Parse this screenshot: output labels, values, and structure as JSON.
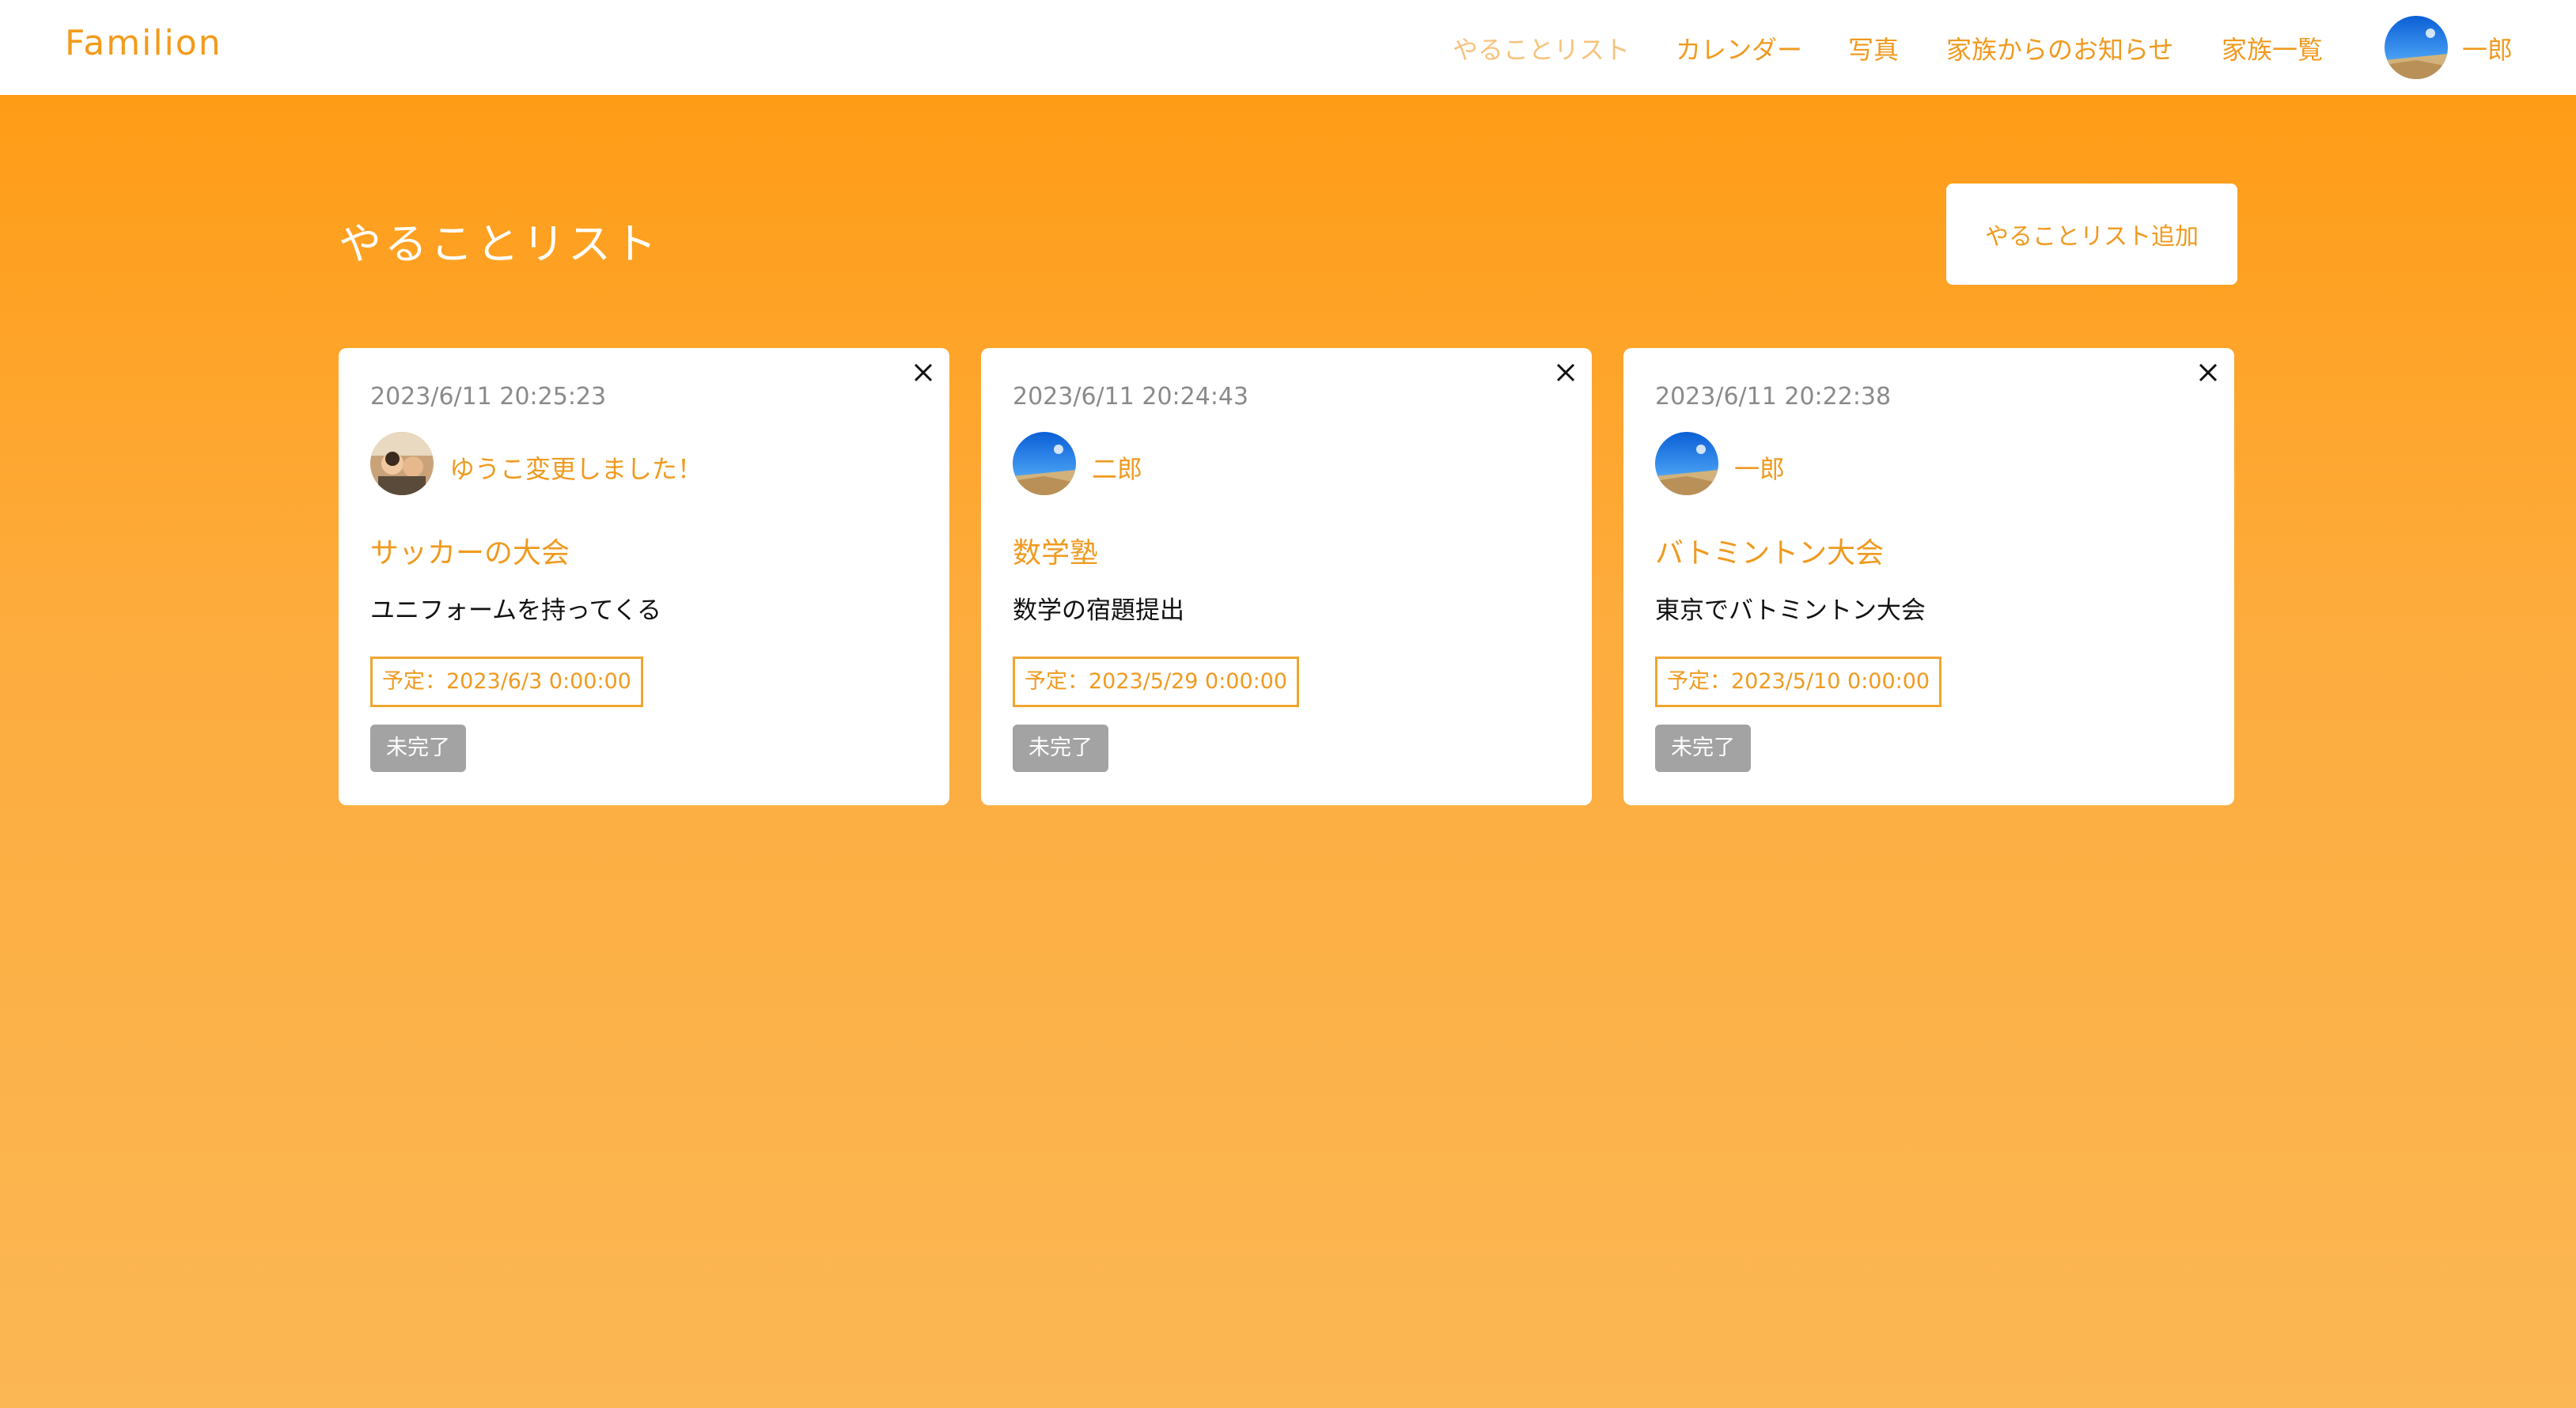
{
  "navbar": {
    "brand": "Familion",
    "items": [
      {
        "label": "やることリスト",
        "active": true
      },
      {
        "label": "カレンダー"
      },
      {
        "label": "写真"
      },
      {
        "label": "家族からのお知らせ"
      },
      {
        "label": "家族一覧"
      }
    ],
    "user_name": "一郎",
    "accent_color": "#ef9a1f"
  },
  "page": {
    "title": "やることリスト",
    "add_button_label": "やることリスト追加"
  },
  "todos": [
    {
      "created_at": "2023/6/11 20:25:23",
      "user": "ゆうこ変更しました！",
      "avatar": "family-photo-avatar",
      "title": "サッカーの大会",
      "description": "ユニフォームを持ってくる",
      "due": "予定：2023/6/3 0:00:00",
      "status": "未完了"
    },
    {
      "created_at": "2023/6/11 20:24:43",
      "user": "二郎",
      "avatar": "sky-photo-avatar",
      "title": "数学塾",
      "description": "数学の宿題提出",
      "due": "予定：2023/5/29 0:00:00",
      "status": "未完了"
    },
    {
      "created_at": "2023/6/11 20:22:38",
      "user": "一郎",
      "avatar": "sky-photo-avatar",
      "title": "バトミントン大会",
      "description": "東京でバトミントン大会",
      "due": "予定：2023/5/10 0:00:00",
      "status": "未完了"
    }
  ]
}
